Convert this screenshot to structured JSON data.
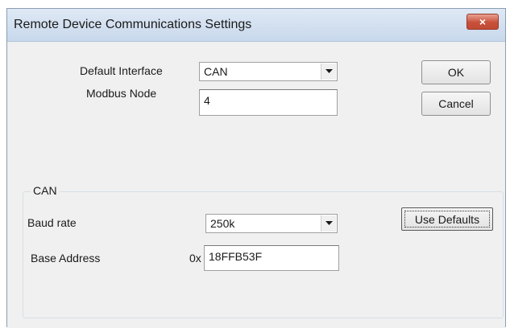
{
  "window": {
    "title": "Remote Device Communications Settings",
    "close_symbol": "×"
  },
  "general": {
    "default_interface": {
      "label": "Default Interface",
      "value": "CAN"
    },
    "modbus_node": {
      "label": "Modbus Node",
      "value": "4"
    },
    "ok_label": "OK",
    "cancel_label": "Cancel"
  },
  "can_group": {
    "title": "CAN",
    "baud_rate": {
      "label": "Baud rate",
      "value": "250k"
    },
    "base_address": {
      "label": "Base Address",
      "prefix": "0x",
      "value": "18FFB53F"
    },
    "use_defaults_label": "Use Defaults"
  },
  "icons": {
    "close": "close-icon",
    "dropdown": "chevron-down-icon"
  },
  "colors": {
    "close_button": "#c9503a",
    "dialog_background": "#f0f0f0",
    "titlebar": "#c8d8ec"
  }
}
